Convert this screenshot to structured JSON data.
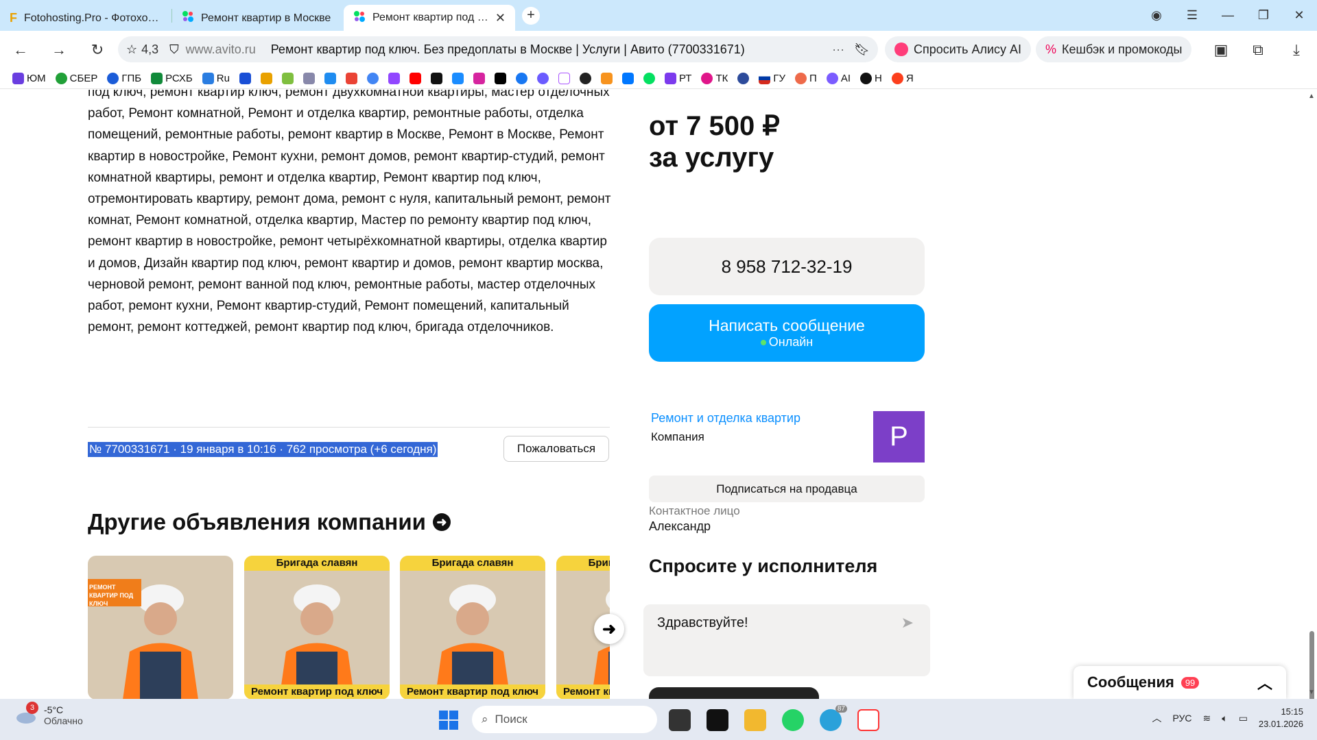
{
  "browser": {
    "tabs": [
      {
        "title": "Fotohosting.Pro - Фотохостинг",
        "active": false
      },
      {
        "title": "Ремонт квартир в Москве",
        "active": false
      },
      {
        "title": "Ремонт квартир под ключ",
        "active": true
      }
    ],
    "rating": "4,3",
    "domain": "www.avito.ru",
    "page_title": "Ремонт квартир под ключ. Без предоплаты в Москве | Услуги | Авито (7700331671)",
    "alice_label": "Спросить Алису AI",
    "cashback_label": "Кешбэк и промокоды",
    "bookmarks": [
      "ЮМ",
      "СБЕР",
      "ГПБ",
      "РСХБ",
      "Ru",
      "",
      "",
      "",
      "",
      "",
      "",
      "",
      "",
      "",
      "",
      "",
      "",
      "",
      "",
      "",
      "",
      "",
      "",
      "РТ",
      "ТК",
      "",
      "ГУ",
      "П",
      "AI",
      "Н",
      "Я"
    ]
  },
  "listing": {
    "description": "под ключ, ремонт квартир ключ, ремонт двухкомнатной квартиры, мастер отделочных работ, Ремонт комнатной, Ремонт и отделка квартир, ремонтные работы, отделка помещений, ремонтные работы, ремонт квартир в Москве, Ремонт в Москве, Ремонт квартир в новостройке, Ремонт кухни, ремонт домов, ремонт квартир-студий, ремонт комнатной квартиры, ремонт и отделка квартир, Ремонт квартир под ключ, отремонтировать квартиру, ремонт дома, ремонт с нуля, капитальный ремонт, ремонт комнат, Ремонт комнатной, отделка квартир, Мастер по ремонту квартир под ключ, ремонт квартир в новостройке, ремонт четырёхкомнатной квартиры, отделка квартир и домов, Дизайн квартир под ключ, ремонт квартир и домов, ремонт квартир москва, черновой ремонт, ремонт ванной под ключ, ремонтные работы, мастер отделочных работ, ремонт кухни, Ремонт квартир-студий, Ремонт помещений, капитальный ремонт, ремонт коттеджей, ремонт квартир под ключ, бригада отделочников.",
    "meta": "№ 7700331671 · 19 января в 10:16 · 762 просмотра (+6 сегодня)",
    "complain_label": "Пожаловаться",
    "other_heading": "Другие объявления компании",
    "cards": [
      {
        "top": "",
        "badge": "РЕМОНТ КВАРТИР ПОД КЛЮЧ",
        "bottom": ""
      },
      {
        "top": "Бригада славян",
        "badge": "",
        "bottom": "Ремонт квартир под ключ"
      },
      {
        "top": "Бригада славян",
        "badge": "",
        "bottom": "Ремонт квартир под ключ"
      },
      {
        "top": "Бригада славян",
        "badge": "",
        "bottom": "Ремонт квартир под ключ"
      }
    ]
  },
  "sidebar": {
    "price_line1": "от 7 500 ₽",
    "price_line2": "за услугу",
    "phone": "8 958 712-32-19",
    "message_label": "Написать сообщение",
    "online_label": "Онлайн",
    "seller_name": "Ремонт и отделка квартир",
    "seller_type": "Компания",
    "avatar_letter": "Р",
    "subscribe_label": "Подписаться на продавца",
    "contact_label": "Контактное лицо",
    "contact_name": "Александр",
    "ask_heading": "Спросите у исполнителя",
    "ask_text": "Здравствуйте!"
  },
  "messages_panel": {
    "title": "Сообщения",
    "count": "99"
  },
  "taskbar": {
    "temp": "-5°C",
    "weather": "Облачно",
    "weather_badge": "3",
    "search_placeholder": "Поиск",
    "lang": "РУС",
    "time": "15:15",
    "date": "23.01.2026",
    "telegram_badge": "87"
  },
  "colors": {
    "accent": "#02a2ff",
    "avatar": "#7c3fc8",
    "selection": "#3367d6"
  }
}
